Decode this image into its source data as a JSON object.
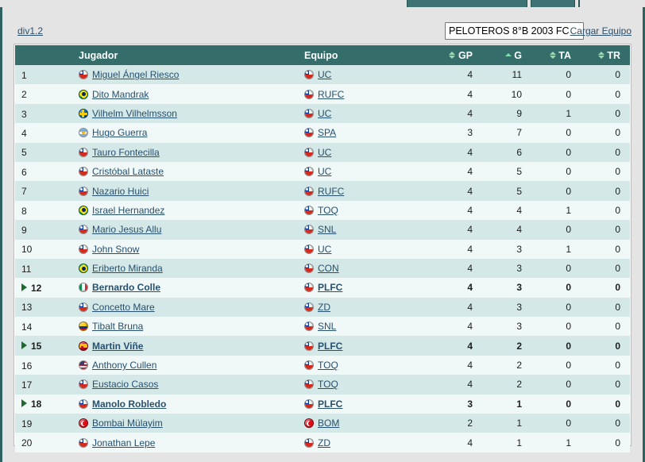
{
  "window": {
    "tabs_visible": true
  },
  "toolbar": {
    "division_link": "div1.2",
    "team_select_value": "PELOTEROS 8°B 2003 FC",
    "team_select_options": [
      "PELOTEROS 8°B 2003 FC"
    ],
    "load_team_link": "Cargar Equipo"
  },
  "table": {
    "headers": {
      "position": "",
      "player": "Jugador",
      "team": "Equipo",
      "gp": "GP",
      "g": "G",
      "ta": "TA",
      "tr": "TR"
    },
    "sort": {
      "active_column": "G",
      "direction": "asc"
    },
    "rows": [
      {
        "pos": "1",
        "marker": false,
        "flag": "cl",
        "player": "Miguel Ángel Riesco",
        "team_flag": "cl",
        "team": "UC",
        "gp": "4",
        "g": "11",
        "ta": "0",
        "tr": "0",
        "highlight": false
      },
      {
        "pos": "2",
        "marker": false,
        "flag": "br",
        "player": "Dito Mandrak",
        "team_flag": "cl",
        "team": "RUFC",
        "gp": "4",
        "g": "10",
        "ta": "0",
        "tr": "0",
        "highlight": false
      },
      {
        "pos": "3",
        "marker": false,
        "flag": "se",
        "player": "Vilhelm Vilhelmsson",
        "team_flag": "cl",
        "team": "UC",
        "gp": "4",
        "g": "9",
        "ta": "1",
        "tr": "0",
        "highlight": false
      },
      {
        "pos": "4",
        "marker": false,
        "flag": "ar",
        "player": "Hugo Guerra",
        "team_flag": "cl",
        "team": "SPA",
        "gp": "3",
        "g": "7",
        "ta": "0",
        "tr": "0",
        "highlight": false
      },
      {
        "pos": "5",
        "marker": false,
        "flag": "cl",
        "player": "Tauro Fontecilla",
        "team_flag": "cl",
        "team": "UC",
        "gp": "4",
        "g": "6",
        "ta": "0",
        "tr": "0",
        "highlight": false
      },
      {
        "pos": "6",
        "marker": false,
        "flag": "cl",
        "player": "Cristóbal Lataste",
        "team_flag": "cl",
        "team": "UC",
        "gp": "4",
        "g": "5",
        "ta": "0",
        "tr": "0",
        "highlight": false
      },
      {
        "pos": "7",
        "marker": false,
        "flag": "cl",
        "player": "Nazario Huici",
        "team_flag": "cl",
        "team": "RUFC",
        "gp": "4",
        "g": "5",
        "ta": "0",
        "tr": "0",
        "highlight": false
      },
      {
        "pos": "8",
        "marker": false,
        "flag": "br",
        "player": "Israel Hernandez",
        "team_flag": "cl",
        "team": "TOQ",
        "gp": "4",
        "g": "4",
        "ta": "1",
        "tr": "0",
        "highlight": false
      },
      {
        "pos": "9",
        "marker": false,
        "flag": "cl",
        "player": "Mario Jesus Allu",
        "team_flag": "cl",
        "team": "SNL",
        "gp": "4",
        "g": "4",
        "ta": "0",
        "tr": "0",
        "highlight": false
      },
      {
        "pos": "10",
        "marker": false,
        "flag": "cl",
        "player": "John Snow",
        "team_flag": "cl",
        "team": "UC",
        "gp": "4",
        "g": "3",
        "ta": "1",
        "tr": "0",
        "highlight": false
      },
      {
        "pos": "11",
        "marker": false,
        "flag": "br",
        "player": "Eriberto Miranda",
        "team_flag": "cl",
        "team": "CON",
        "gp": "4",
        "g": "3",
        "ta": "0",
        "tr": "0",
        "highlight": false
      },
      {
        "pos": "12",
        "marker": true,
        "flag": "it",
        "player": "Bernardo Colle",
        "team_flag": "cl",
        "team": "PLFC",
        "gp": "4",
        "g": "3",
        "ta": "0",
        "tr": "0",
        "highlight": true
      },
      {
        "pos": "13",
        "marker": false,
        "flag": "cl",
        "player": "Concetto Mare",
        "team_flag": "cl",
        "team": "ZD",
        "gp": "4",
        "g": "3",
        "ta": "0",
        "tr": "0",
        "highlight": false
      },
      {
        "pos": "14",
        "marker": false,
        "flag": "co",
        "player": "Tibalt Bruna",
        "team_flag": "cl",
        "team": "SNL",
        "gp": "4",
        "g": "3",
        "ta": "0",
        "tr": "0",
        "highlight": false
      },
      {
        "pos": "15",
        "marker": true,
        "flag": "es",
        "player": "Martin Viñe",
        "team_flag": "cl",
        "team": "PLFC",
        "gp": "4",
        "g": "2",
        "ta": "0",
        "tr": "0",
        "highlight": true
      },
      {
        "pos": "16",
        "marker": false,
        "flag": "us",
        "player": "Anthony Cullen",
        "team_flag": "cl",
        "team": "TOQ",
        "gp": "4",
        "g": "2",
        "ta": "0",
        "tr": "0",
        "highlight": false
      },
      {
        "pos": "17",
        "marker": false,
        "flag": "cl",
        "player": "Eustacio Casos",
        "team_flag": "cl",
        "team": "TOQ",
        "gp": "4",
        "g": "2",
        "ta": "0",
        "tr": "0",
        "highlight": false
      },
      {
        "pos": "18",
        "marker": true,
        "flag": "cl",
        "player": "Manolo Robledo",
        "team_flag": "cl",
        "team": "PLFC",
        "gp": "3",
        "g": "1",
        "ta": "0",
        "tr": "0",
        "highlight": true
      },
      {
        "pos": "19",
        "marker": false,
        "flag": "tr",
        "player": "Bombai Mülayim",
        "team_flag": "tr",
        "team": "BOM",
        "gp": "2",
        "g": "1",
        "ta": "0",
        "tr": "0",
        "highlight": false
      },
      {
        "pos": "20",
        "marker": false,
        "flag": "cl",
        "player": "Jonathan Lepe",
        "team_flag": "cl",
        "team": "ZD",
        "gp": "4",
        "g": "1",
        "ta": "1",
        "tr": "0",
        "highlight": false
      }
    ]
  },
  "colors": {
    "header_bg": "#356d6b",
    "frame_border": "#2f6160",
    "row_odd": "#d4e8e7",
    "row_even": "#f1f8f8",
    "link": "#27506e",
    "marker_green": "#1d6a2f"
  }
}
